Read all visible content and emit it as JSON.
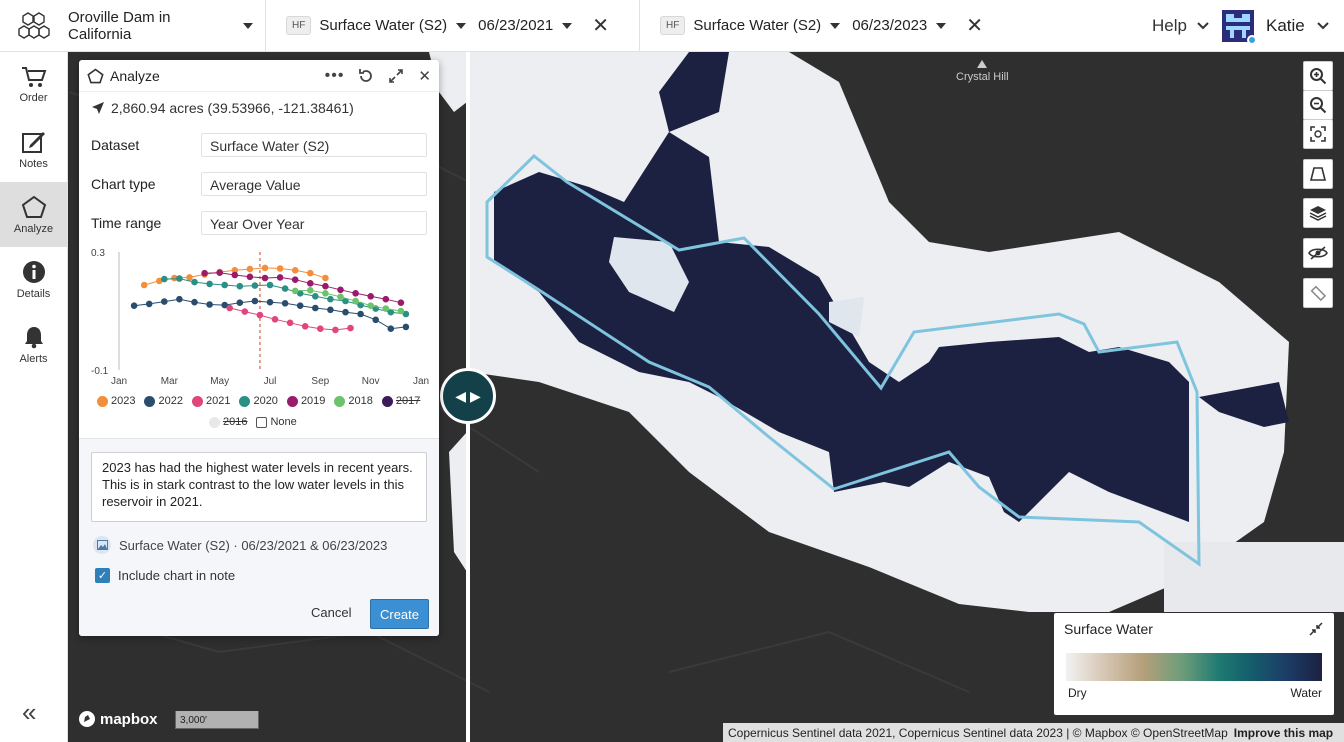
{
  "header": {
    "location": "Oroville Dam in California",
    "layers": [
      {
        "badge": "HF",
        "dataset": "Surface Water (S2)",
        "date": "06/23/2021"
      },
      {
        "badge": "HF",
        "dataset": "Surface Water (S2)",
        "date": "06/23/2023"
      }
    ],
    "help_label": "Help",
    "user_name": "Katie"
  },
  "sidebar": {
    "items": [
      {
        "label": "Order",
        "icon": "cart-icon"
      },
      {
        "label": "Notes",
        "icon": "note-edit-icon"
      },
      {
        "label": "Analyze",
        "icon": "pentagon-icon",
        "active": true
      },
      {
        "label": "Details",
        "icon": "info-icon"
      },
      {
        "label": "Alerts",
        "icon": "bell-icon"
      }
    ],
    "collapse_label": "«"
  },
  "analyze": {
    "title": "Analyze",
    "area": "2,860.94 acres (39.53966, -121.38461)",
    "fields": [
      {
        "label": "Dataset",
        "value": "Surface Water (S2)"
      },
      {
        "label": "Chart type",
        "value": "Average Value"
      },
      {
        "label": "Time range",
        "value": "Year Over Year"
      }
    ],
    "note_text": "2023 has had the highest water levels in recent years. This is in stark contrast to the low water levels in this reservoir in 2021.",
    "attachment": "Surface Water (S2) · 06/23/2021 & 06/23/2023",
    "include_chart_label": "Include chart in note",
    "cancel_label": "Cancel",
    "create_label": "Create"
  },
  "chart_data": {
    "type": "scatter",
    "y_ticks": [
      "0.3",
      "-0.1"
    ],
    "x_ticks": [
      "Jan",
      "Mar",
      "May",
      "Jul",
      "Sep",
      "Nov",
      "Jan"
    ],
    "ylim": [
      -0.1,
      0.3
    ],
    "xlim": [
      0,
      12
    ],
    "marker_x": 5.6,
    "series": [
      {
        "name": "2023",
        "color": "#f28e3c",
        "values": [
          [
            1.0,
            0.188
          ],
          [
            1.6,
            0.202
          ],
          [
            2.2,
            0.212
          ],
          [
            2.8,
            0.214
          ],
          [
            3.4,
            0.224
          ],
          [
            4.0,
            0.232
          ],
          [
            4.6,
            0.238
          ],
          [
            5.2,
            0.242
          ],
          [
            5.8,
            0.246
          ],
          [
            6.4,
            0.244
          ],
          [
            7.0,
            0.238
          ],
          [
            7.6,
            0.228
          ],
          [
            8.2,
            0.212
          ]
        ]
      },
      {
        "name": "2022",
        "color": "#2a4d6e",
        "values": [
          [
            0.6,
            0.118
          ],
          [
            1.2,
            0.124
          ],
          [
            1.8,
            0.132
          ],
          [
            2.4,
            0.14
          ],
          [
            3.0,
            0.13
          ],
          [
            3.6,
            0.122
          ],
          [
            4.2,
            0.12
          ],
          [
            4.8,
            0.128
          ],
          [
            5.4,
            0.134
          ],
          [
            6.0,
            0.13
          ],
          [
            6.6,
            0.126
          ],
          [
            7.2,
            0.118
          ],
          [
            7.8,
            0.11
          ],
          [
            8.4,
            0.104
          ],
          [
            9.0,
            0.096
          ],
          [
            9.6,
            0.09
          ],
          [
            10.2,
            0.07
          ],
          [
            10.8,
            0.04
          ],
          [
            11.4,
            0.046
          ]
        ]
      },
      {
        "name": "2021",
        "color": "#e0457b",
        "values": [
          [
            4.4,
            0.11
          ],
          [
            5.0,
            0.098
          ],
          [
            5.6,
            0.086
          ],
          [
            6.2,
            0.072
          ],
          [
            6.8,
            0.06
          ],
          [
            7.4,
            0.048
          ],
          [
            8.0,
            0.04
          ],
          [
            8.6,
            0.036
          ],
          [
            9.2,
            0.042
          ]
        ]
      },
      {
        "name": "2020",
        "color": "#2a8f85",
        "values": [
          [
            1.8,
            0.208
          ],
          [
            2.4,
            0.21
          ],
          [
            3.0,
            0.198
          ],
          [
            3.6,
            0.192
          ],
          [
            4.2,
            0.188
          ],
          [
            4.8,
            0.184
          ],
          [
            5.4,
            0.186
          ],
          [
            6.0,
            0.188
          ],
          [
            6.6,
            0.176
          ],
          [
            7.2,
            0.16
          ],
          [
            7.8,
            0.15
          ],
          [
            8.4,
            0.14
          ],
          [
            9.0,
            0.134
          ],
          [
            9.6,
            0.12
          ],
          [
            10.2,
            0.108
          ],
          [
            10.8,
            0.096
          ],
          [
            11.4,
            0.09
          ]
        ]
      },
      {
        "name": "2019",
        "color": "#9b1b6b",
        "values": [
          [
            3.4,
            0.228
          ],
          [
            4.0,
            0.23
          ],
          [
            4.6,
            0.222
          ],
          [
            5.2,
            0.216
          ],
          [
            5.8,
            0.212
          ],
          [
            6.4,
            0.214
          ],
          [
            7.0,
            0.206
          ],
          [
            7.6,
            0.194
          ],
          [
            8.2,
            0.184
          ],
          [
            8.8,
            0.172
          ],
          [
            9.4,
            0.16
          ],
          [
            10.0,
            0.15
          ],
          [
            10.6,
            0.14
          ],
          [
            11.2,
            0.128
          ]
        ]
      },
      {
        "name": "2018",
        "color": "#6cc36b",
        "values": [
          [
            7.0,
            0.168
          ],
          [
            7.6,
            0.17
          ],
          [
            8.2,
            0.16
          ],
          [
            8.8,
            0.148
          ],
          [
            9.4,
            0.134
          ],
          [
            10.0,
            0.118
          ],
          [
            10.6,
            0.108
          ],
          [
            11.2,
            0.1
          ]
        ]
      },
      {
        "name": "2017",
        "color": "#3d1a5a",
        "hidden": true,
        "values": []
      },
      {
        "name": "2016",
        "color": "#e8e8e8",
        "hidden": true,
        "values": []
      }
    ],
    "none_label": "None"
  },
  "map": {
    "place_label": "Crystal Hill",
    "scale_label": "3,000′",
    "attribution": "Copernicus Sentinel data 2021, Copernicus Sentinel data 2023 | © Mapbox © OpenStreetMap",
    "improve_label": "Improve this map",
    "mapbox_label": "mapbox"
  },
  "legend": {
    "title": "Surface Water",
    "low": "Dry",
    "high": "Water"
  },
  "colors": {
    "water": "#1c2142",
    "land_mask": "#eceef1",
    "aoi_outline": "#7fc4de",
    "accent": "#3b8fd3"
  }
}
